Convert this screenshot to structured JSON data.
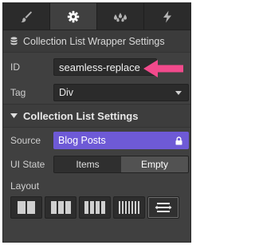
{
  "tabs": [
    {
      "icon": "brush-icon",
      "active": false
    },
    {
      "icon": "gear-icon",
      "active": true
    },
    {
      "icon": "drops-icon",
      "active": false
    },
    {
      "icon": "lightning-icon",
      "active": false
    }
  ],
  "wrapper": {
    "title": "Collection List Wrapper Settings",
    "icon": "database-icon"
  },
  "id_field": {
    "label": "ID",
    "value": "seamless-replace"
  },
  "tag_field": {
    "label": "Tag",
    "value": "Div"
  },
  "settings": {
    "title": "Collection List Settings"
  },
  "source": {
    "label": "Source",
    "value": "Blog Posts"
  },
  "ui_state": {
    "label": "UI State",
    "options": [
      "Items",
      "Empty"
    ],
    "selected": "Empty"
  },
  "layout": {
    "label": "Layout",
    "options": [
      "1-column-icon",
      "2-columns-icon",
      "3-columns-icon",
      "4-columns-icon",
      "rows-icon"
    ],
    "selected": "rows-icon"
  },
  "colors": {
    "source_bg": "#6e5ad6",
    "arrow": "#f24a8c",
    "panel_bg": "#404040"
  }
}
